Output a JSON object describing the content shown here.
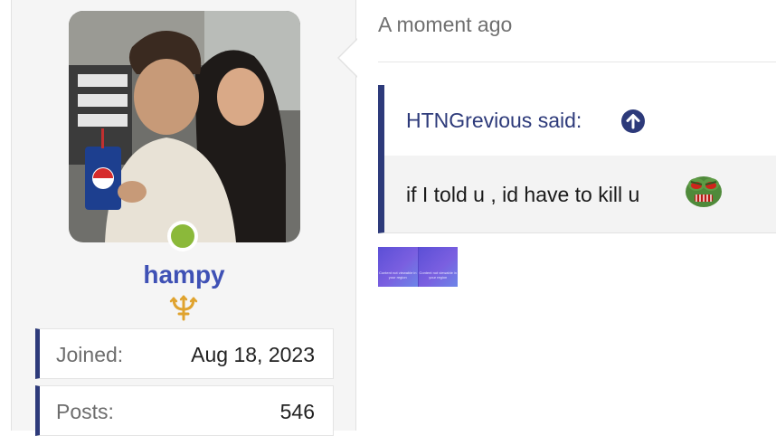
{
  "user": {
    "username": "hampy",
    "online": true,
    "badge_icon": "trident-icon",
    "stats": [
      {
        "label": "Joined:",
        "value": "Aug 18, 2023"
      },
      {
        "label": "Posts:",
        "value": "546"
      }
    ]
  },
  "post": {
    "timestamp": "A moment ago",
    "quote": {
      "author": "HTNGrevious said:",
      "author_icon": "arrow-up-icon",
      "text": "if I told u , id have to kill u",
      "emoji_icon": "angry-pepe-icon"
    },
    "media": {
      "tiles": [
        "Content not viewable in your region",
        "Content not viewable in your region"
      ]
    }
  },
  "colors": {
    "accent": "#2d3a7a",
    "username": "#3f51b5",
    "online": "#8bb93a"
  }
}
